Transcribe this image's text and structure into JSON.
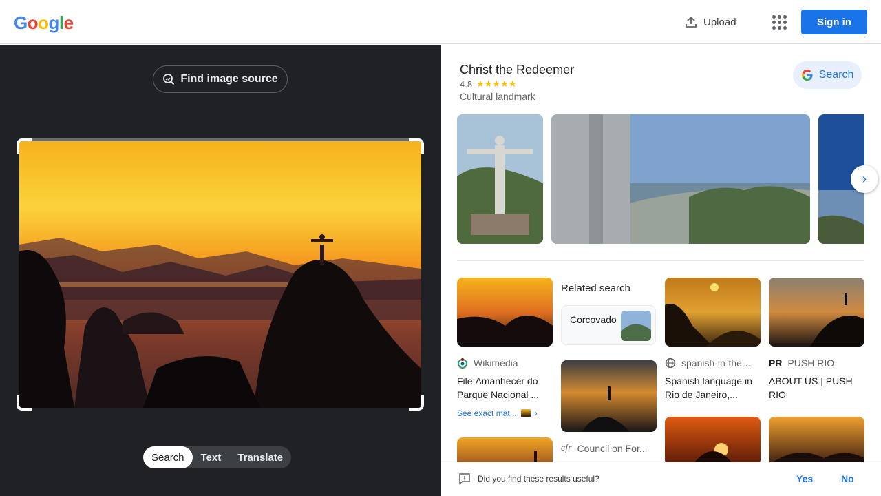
{
  "header": {
    "logo_letters": [
      "G",
      "o",
      "o",
      "g",
      "l",
      "e"
    ],
    "upload_label": "Upload",
    "signin_label": "Sign in"
  },
  "left": {
    "find_source_label": "Find image source",
    "modes": [
      "Search",
      "Text",
      "Translate"
    ],
    "active_mode": "Search"
  },
  "knowledge_panel": {
    "title": "Christ the Redeemer",
    "rating": "4.8",
    "stars": "★★★★★",
    "type": "Cultural landmark",
    "search_label": "Search"
  },
  "results": {
    "card1": {
      "source": "Wikimedia",
      "title": "File:Amanhecer do Parque Nacional ...",
      "see_exact": "See exact mat..."
    },
    "related": {
      "heading": "Related search",
      "chip_label": "Corcovado"
    },
    "card3": {
      "source": "spanish-in-the-...",
      "title": "Spanish language in Rio de Janeiro,..."
    },
    "card4": {
      "source": "PUSH RIO",
      "source_badge": "PR",
      "title": "ABOUT US | PUSH RIO"
    },
    "card6": {
      "source": "Council on For...",
      "source_badge": "cfr"
    }
  },
  "feedback": {
    "question": "Did you find these results useful?",
    "yes": "Yes",
    "no": "No"
  },
  "colors": {
    "accent": "#1a73e8",
    "dark_panel": "#202124",
    "star": "#fbbc04"
  }
}
